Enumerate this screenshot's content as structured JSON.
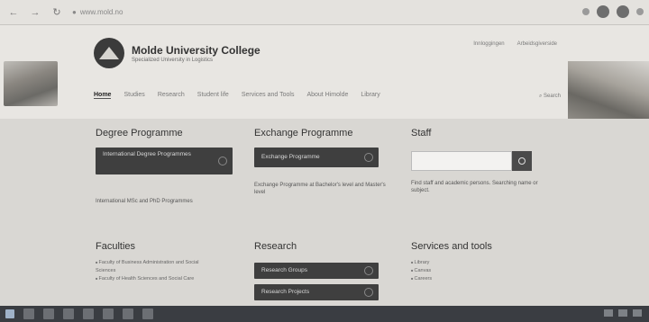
{
  "browser": {
    "url": "www.mold.no",
    "nav_icons": [
      "back-icon",
      "forward-icon",
      "reload-icon",
      "lock-icon"
    ]
  },
  "header": {
    "logo_name": "Molde University College",
    "logo_sub": "Specialized University in Logistics",
    "top_links": [
      "Innloggingen",
      "Arbeidsgiverside"
    ],
    "nav": [
      "Home",
      "Studies",
      "Research",
      "Student life",
      "Services and Tools",
      "About Himolde",
      "Library"
    ],
    "search_label": "Search"
  },
  "degree": {
    "title": "Degree Programme",
    "button": "International Degree Programmes",
    "link": "International MSc and PhD Programmes"
  },
  "exchange": {
    "title": "Exchange Programme",
    "button": "Exchange Programme",
    "text": "Exchange Programme at Bachelor's level and Master's level"
  },
  "staff": {
    "title": "Staff",
    "text": "Find staff and academic persons. Searching name or subject."
  },
  "faculties": {
    "title": "Faculties",
    "items": [
      "Faculty of Business Administration and Social Sciences",
      "Faculty of Health Sciences and Social Care"
    ]
  },
  "research": {
    "title": "Research",
    "buttons": [
      "Research Groups",
      "Research Projects"
    ]
  },
  "services": {
    "title": "Services and tools",
    "items": [
      "Library",
      "Canvas",
      "Careers"
    ]
  }
}
